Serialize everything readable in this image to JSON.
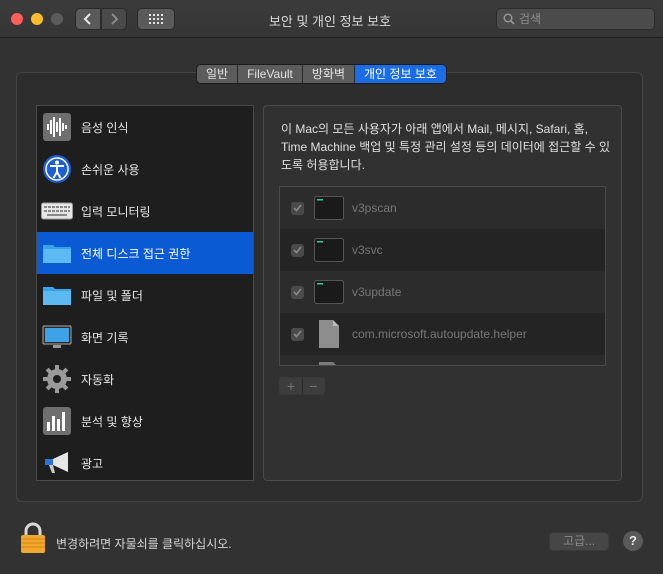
{
  "window": {
    "title": "보안 및 개인 정보 보호",
    "search_placeholder": "검색"
  },
  "tabs": [
    {
      "label": "일반",
      "active": false
    },
    {
      "label": "FileVault",
      "active": false
    },
    {
      "label": "방화벽",
      "active": false
    },
    {
      "label": "개인 정보 보호",
      "active": true
    }
  ],
  "categories": [
    {
      "label": "음성 인식",
      "icon": "waveform-icon",
      "selected": false
    },
    {
      "label": "손쉬운 사용",
      "icon": "accessibility-icon",
      "selected": false
    },
    {
      "label": "입력 모니터링",
      "icon": "keyboard-icon",
      "selected": false
    },
    {
      "label": "전체 디스크 접근 권한",
      "icon": "folder-icon",
      "selected": true
    },
    {
      "label": "파일 및 폴더",
      "icon": "folder-icon",
      "selected": false
    },
    {
      "label": "화면 기록",
      "icon": "display-icon",
      "selected": false
    },
    {
      "label": "자동화",
      "icon": "gear-icon",
      "selected": false
    },
    {
      "label": "분석 및 향상",
      "icon": "chart-icon",
      "selected": false
    },
    {
      "label": "광고",
      "icon": "megaphone-icon",
      "selected": false
    }
  ],
  "description": "이 Mac의 모든 사용자가 아래 앱에서 Mail, 메시지, Safari, 홈, Time Machine 백업 및 특정 관리 설정 등의 데이터에 접근할 수 있도록 허용합니다.",
  "apps": [
    {
      "name": "v3pscan",
      "checked": true,
      "icon": "terminal-icon"
    },
    {
      "name": "v3svc",
      "checked": true,
      "icon": "terminal-icon"
    },
    {
      "name": "v3update",
      "checked": true,
      "icon": "terminal-icon"
    },
    {
      "name": "com.microsoft.autoupdate.helper",
      "checked": true,
      "icon": "document-icon"
    }
  ],
  "list_buttons": {
    "add": "+",
    "remove": "−"
  },
  "footer": {
    "lock_text": "변경하려면 자물쇠를 클릭하십시오.",
    "advanced_label": "고급...",
    "help_label": "?"
  },
  "colors": {
    "accent": "#1b6de6",
    "selection": "#0a5bd3"
  }
}
